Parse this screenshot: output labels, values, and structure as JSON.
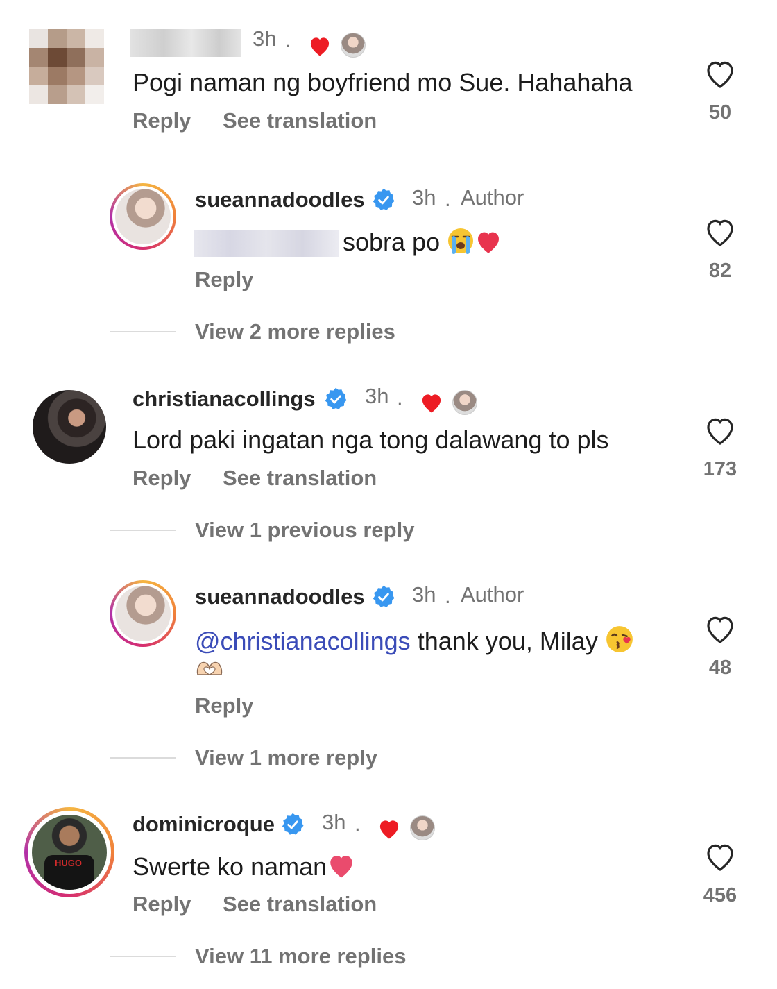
{
  "comments": [
    {
      "username": "",
      "time": "3h",
      "text": "Pogi naman ng boyfriend mo Sue. Hahahaha",
      "reply_label": "Reply",
      "translate_label": "See translation",
      "likes": "50"
    },
    {
      "username": "sueannadoodles",
      "time": "3h",
      "author_label": "Author",
      "text": "sobra po",
      "reply_label": "Reply",
      "likes": "82",
      "view_replies": "View 2 more replies"
    },
    {
      "username": "christianacollings",
      "time": "3h",
      "text": "Lord paki ingatan nga tong dalawang to pls",
      "reply_label": "Reply",
      "translate_label": "See translation",
      "likes": "173",
      "view_replies": "View 1 previous reply"
    },
    {
      "username": "sueannadoodles",
      "time": "3h",
      "author_label": "Author",
      "mention": "@christianacollings",
      "text": "thank you, Milay",
      "reply_label": "Reply",
      "likes": "48",
      "view_replies": "View 1 more reply"
    },
    {
      "username": "dominicroque",
      "time": "3h",
      "text": "Swerte ko naman",
      "reply_label": "Reply",
      "translate_label": "See translation",
      "likes": "456",
      "view_replies": "View 11 more replies",
      "avatar_shirt_text": "HUGO"
    }
  ],
  "separator_dot": ".",
  "colors": {
    "verified_badge": "#3897f0",
    "liked_heart": "#ed1c24",
    "muted_text": "#737373",
    "mention": "#3b4cb8"
  },
  "icons": [
    "heart-outline-icon",
    "verified-badge-icon",
    "liked-by-author-heart-icon",
    "crying-face-emoji",
    "red-heart-emoji",
    "kissing-face-emoji",
    "heart-hands-emoji"
  ]
}
